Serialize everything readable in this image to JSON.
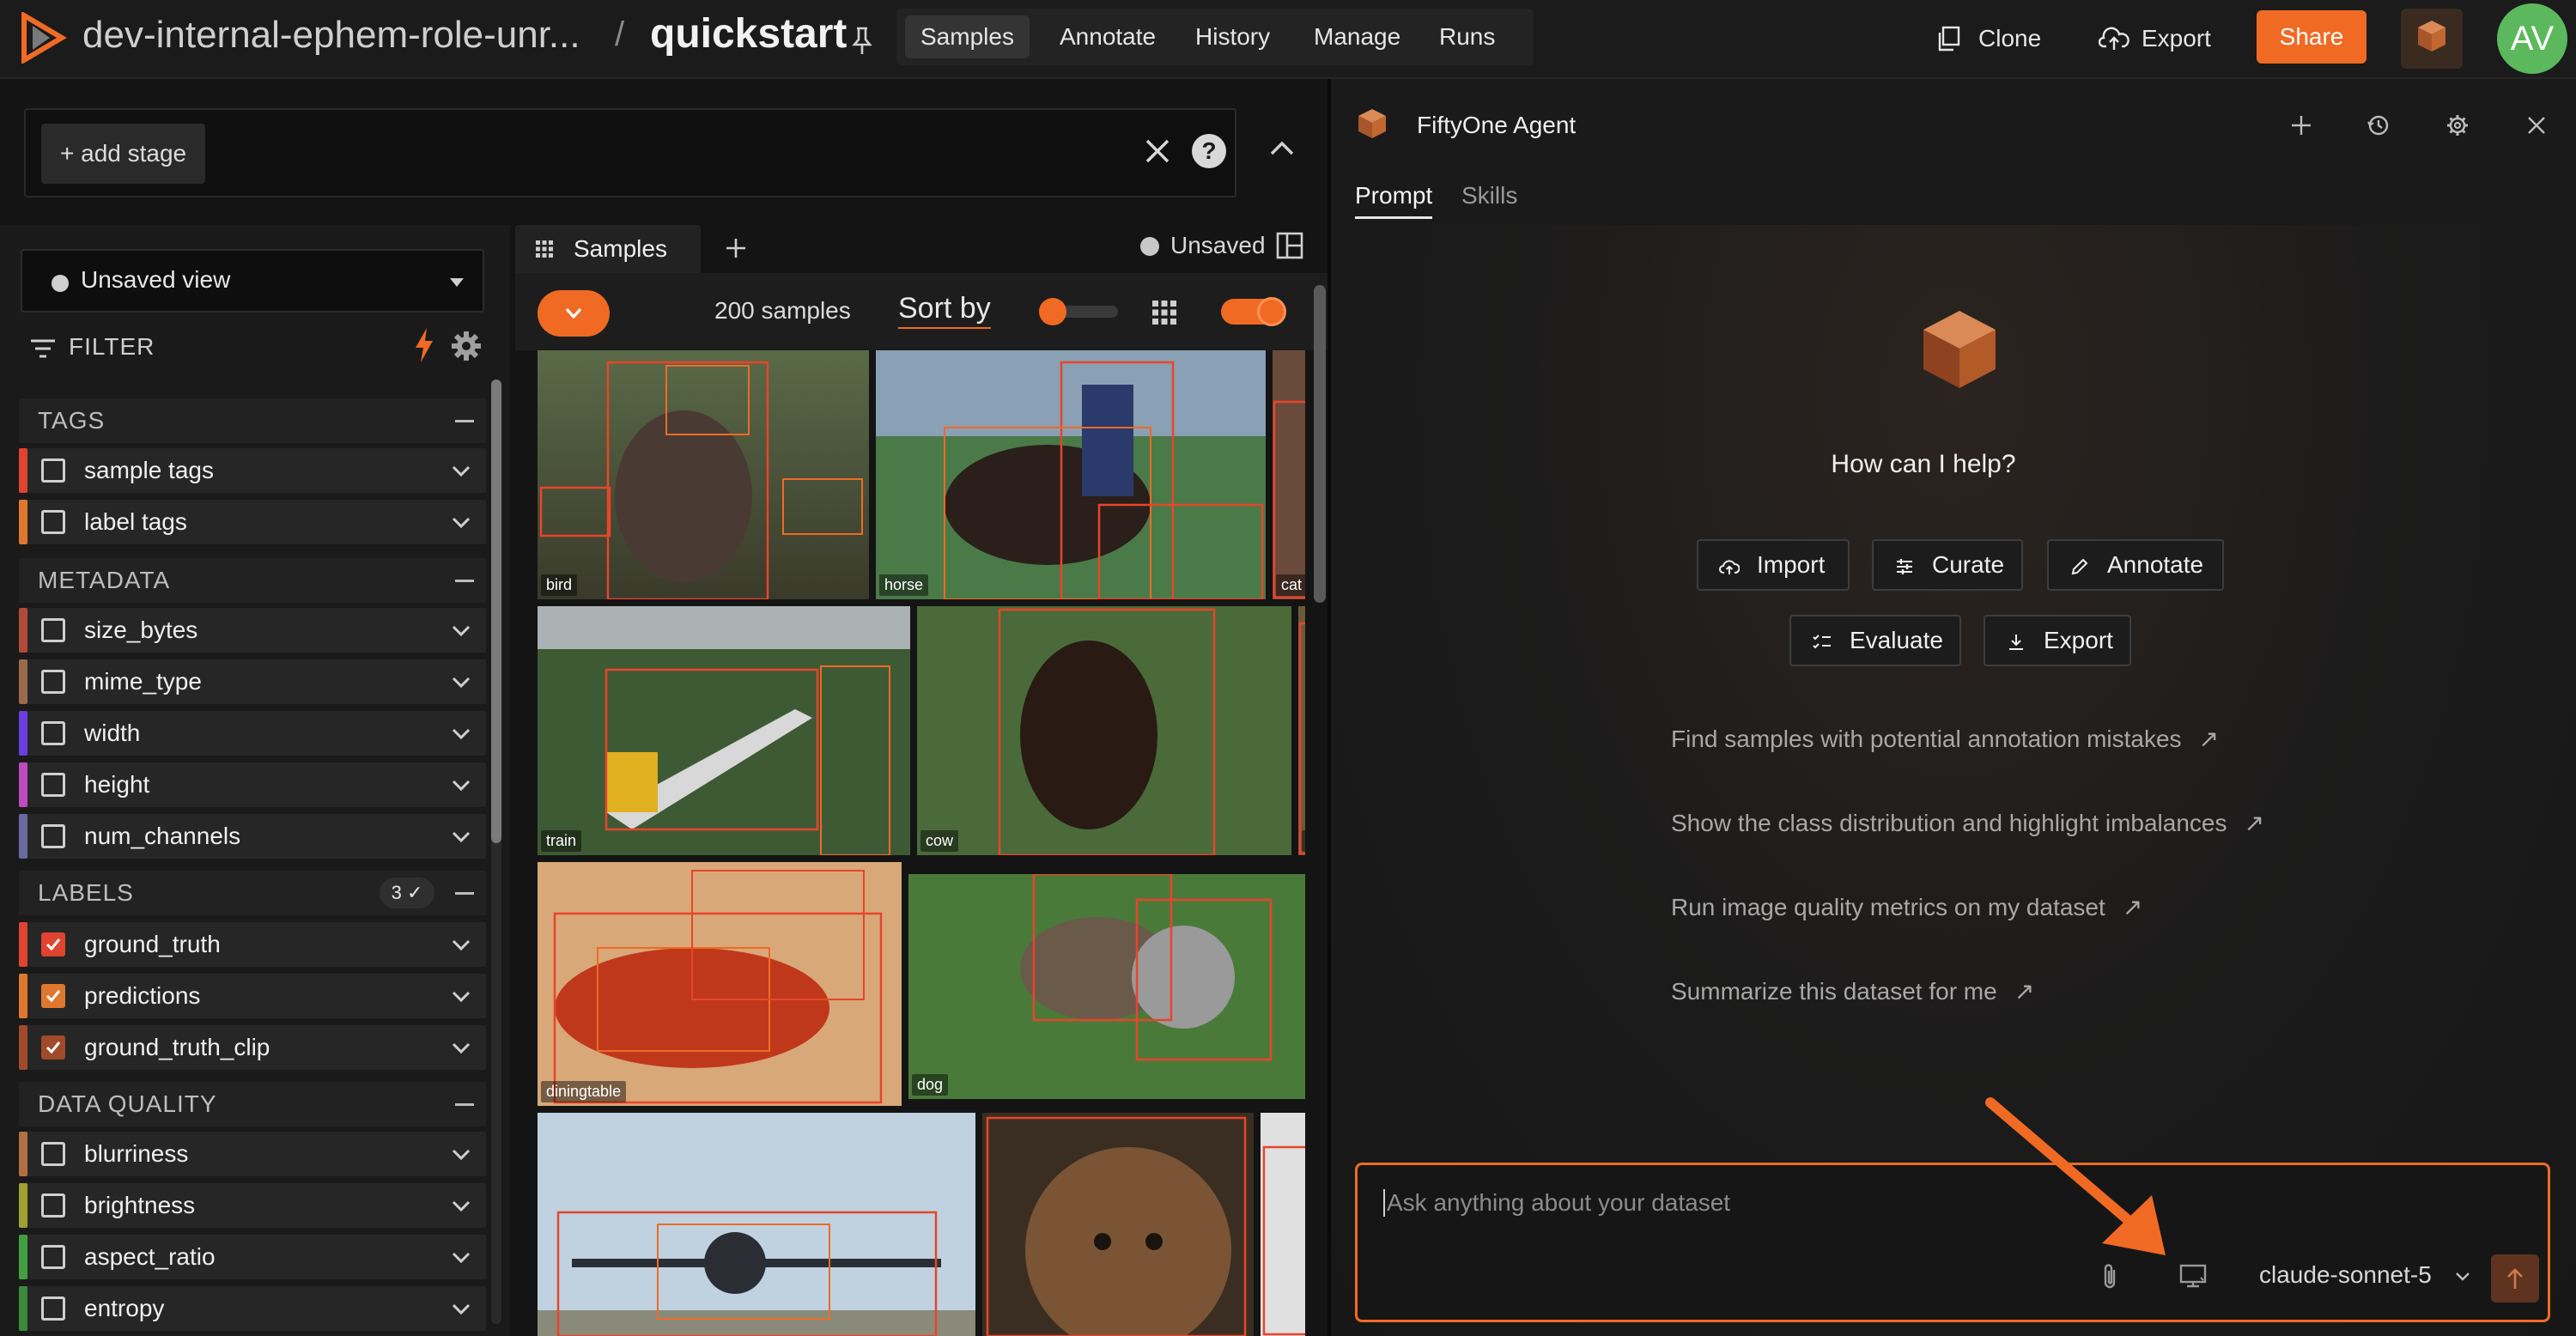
{
  "header": {
    "dataset_name": "dev-internal-ephem-role-unr...",
    "separator": "/",
    "dataset_title": "quickstart",
    "nav_tabs": [
      {
        "label": "Samples",
        "active": true
      },
      {
        "label": "Annotate",
        "active": false
      },
      {
        "label": "History",
        "active": false
      },
      {
        "label": "Manage",
        "active": false
      },
      {
        "label": "Runs",
        "active": false
      }
    ],
    "clone_label": "Clone",
    "export_label": "Export",
    "share_label": "Share",
    "avatar_initials": "AV"
  },
  "stage_bar": {
    "add_stage_label": "+ add stage",
    "help_label": "?"
  },
  "sidebar": {
    "view_label": "Unsaved view",
    "filter_label": "FILTER",
    "sections": [
      {
        "label": "TAGS",
        "rows": [
          {
            "label": "sample tags",
            "color": "#e0432f",
            "checked": false
          },
          {
            "label": "label tags",
            "color": "#e0772f",
            "checked": false
          }
        ]
      },
      {
        "label": "METADATA",
        "rows": [
          {
            "label": "size_bytes",
            "color": "#b24a3a",
            "checked": false
          },
          {
            "label": "mime_type",
            "color": "#9b6a4a",
            "checked": false
          },
          {
            "label": "width",
            "color": "#6a3ee0",
            "checked": false
          },
          {
            "label": "height",
            "color": "#c04ac0",
            "checked": false
          },
          {
            "label": "num_channels",
            "color": "#6a6aa0",
            "checked": false
          }
        ]
      },
      {
        "label": "LABELS",
        "badge": "3",
        "rows": [
          {
            "label": "ground_truth",
            "color": "#e0432f",
            "checked": true
          },
          {
            "label": "predictions",
            "color": "#e0772f",
            "checked": true
          },
          {
            "label": "ground_truth_clip",
            "color": "#a04a2a",
            "checked": true
          }
        ]
      },
      {
        "label": "DATA QUALITY",
        "rows": [
          {
            "label": "blurriness",
            "color": "#b07040",
            "checked": false
          },
          {
            "label": "brightness",
            "color": "#a0a030",
            "checked": false
          },
          {
            "label": "aspect_ratio",
            "color": "#40a040",
            "checked": false
          },
          {
            "label": "entropy",
            "color": "#3a8a3a",
            "checked": false
          }
        ]
      }
    ]
  },
  "samples_panel": {
    "tab_label": "Samples",
    "unsaved_label": "Unsaved",
    "count_label": "200 samples",
    "sort_label": "Sort by",
    "tiles": [
      "bird",
      "horse",
      "cat",
      "train",
      "cow",
      "c",
      "diningtable",
      "dog",
      "",
      "",
      ""
    ],
    "colors": {
      "accent": "#f06a24",
      "box": "#e8452a"
    }
  },
  "agent": {
    "title": "FiftyOne Agent",
    "tabs": [
      {
        "label": "Prompt",
        "active": true
      },
      {
        "label": "Skills",
        "active": false
      }
    ],
    "help_text": "How can I help?",
    "quick_actions": [
      "Import",
      "Curate",
      "Annotate",
      "Evaluate",
      "Export"
    ],
    "suggestions": [
      "Find samples with potential annotation mistakes",
      "Show the class distribution and highlight imbalances",
      "Run image quality metrics on my dataset",
      "Summarize this dataset for me"
    ],
    "prompt_placeholder": "Ask anything about your dataset",
    "model_label": "claude-sonnet-5"
  }
}
